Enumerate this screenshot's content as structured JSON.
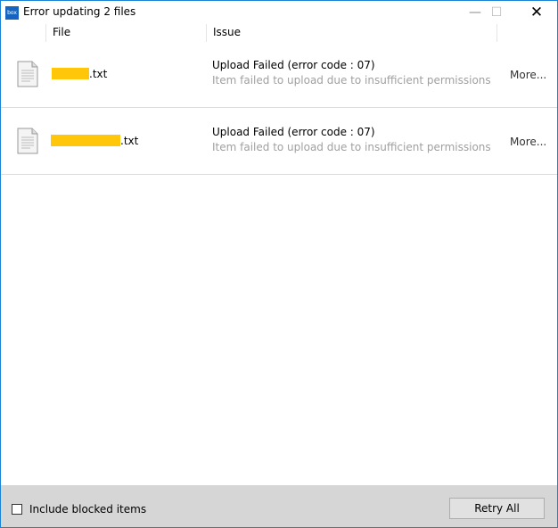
{
  "window": {
    "title": "Error updating 2 files",
    "logo_text": "box"
  },
  "columns": {
    "file": "File",
    "issue": "Issue"
  },
  "rows": [
    {
      "file_ext": ".txt",
      "issue": "Upload Failed (error code : 07)",
      "description": "Item failed to upload due to insufficient permissions",
      "more": "More..."
    },
    {
      "file_ext": ".txt",
      "issue": "Upload Failed (error code : 07)",
      "description": "Item failed to upload due to insufficient permissions",
      "more": "More..."
    }
  ],
  "footer": {
    "include_blocked_label": "Include blocked items",
    "include_blocked_checked": false,
    "retry_label": "Retry All"
  },
  "colors": {
    "accent": "#1883d7",
    "redaction": "#ffc60a"
  }
}
